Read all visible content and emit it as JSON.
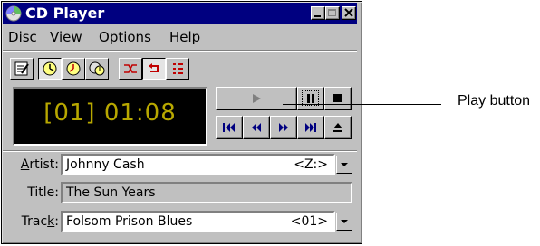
{
  "window": {
    "title": "CD Player"
  },
  "menu": {
    "items": [
      {
        "label_u": "D",
        "label_rest": "isc"
      },
      {
        "label_u": "V",
        "label_rest": "iew"
      },
      {
        "label_u": "O",
        "label_rest": "ptions"
      },
      {
        "label_u": "H",
        "label_rest": "elp"
      }
    ]
  },
  "display": {
    "text": "[01] 01:08"
  },
  "fields": {
    "artist": {
      "label_u": "A",
      "label_rest": "rtist:",
      "value": "Johnny Cash",
      "code": "<Z:>"
    },
    "title": {
      "label": "Title:",
      "value": "The Sun Years"
    },
    "track": {
      "label_pre": "Trac",
      "label_u": "k",
      "label_rest": ":",
      "value": "Folsom Prison Blues",
      "code": "<01>"
    }
  },
  "callout": {
    "text": "Play button"
  },
  "icons": [
    "cd-icon",
    "edit-playlist-icon",
    "track-time-elapsed-icon",
    "track-time-remaining-icon",
    "disc-time-remaining-icon",
    "random-order-icon",
    "continuous-play-icon",
    "intro-play-icon",
    "play-icon",
    "pause-icon",
    "stop-icon",
    "previous-track-icon",
    "skip-back-icon",
    "skip-forward-icon",
    "next-track-icon",
    "eject-icon",
    "dropdown-arrow-icon"
  ],
  "colors": {
    "titlebar": "#000080",
    "display_text": "#b8a800",
    "display_bg": "#000000"
  }
}
